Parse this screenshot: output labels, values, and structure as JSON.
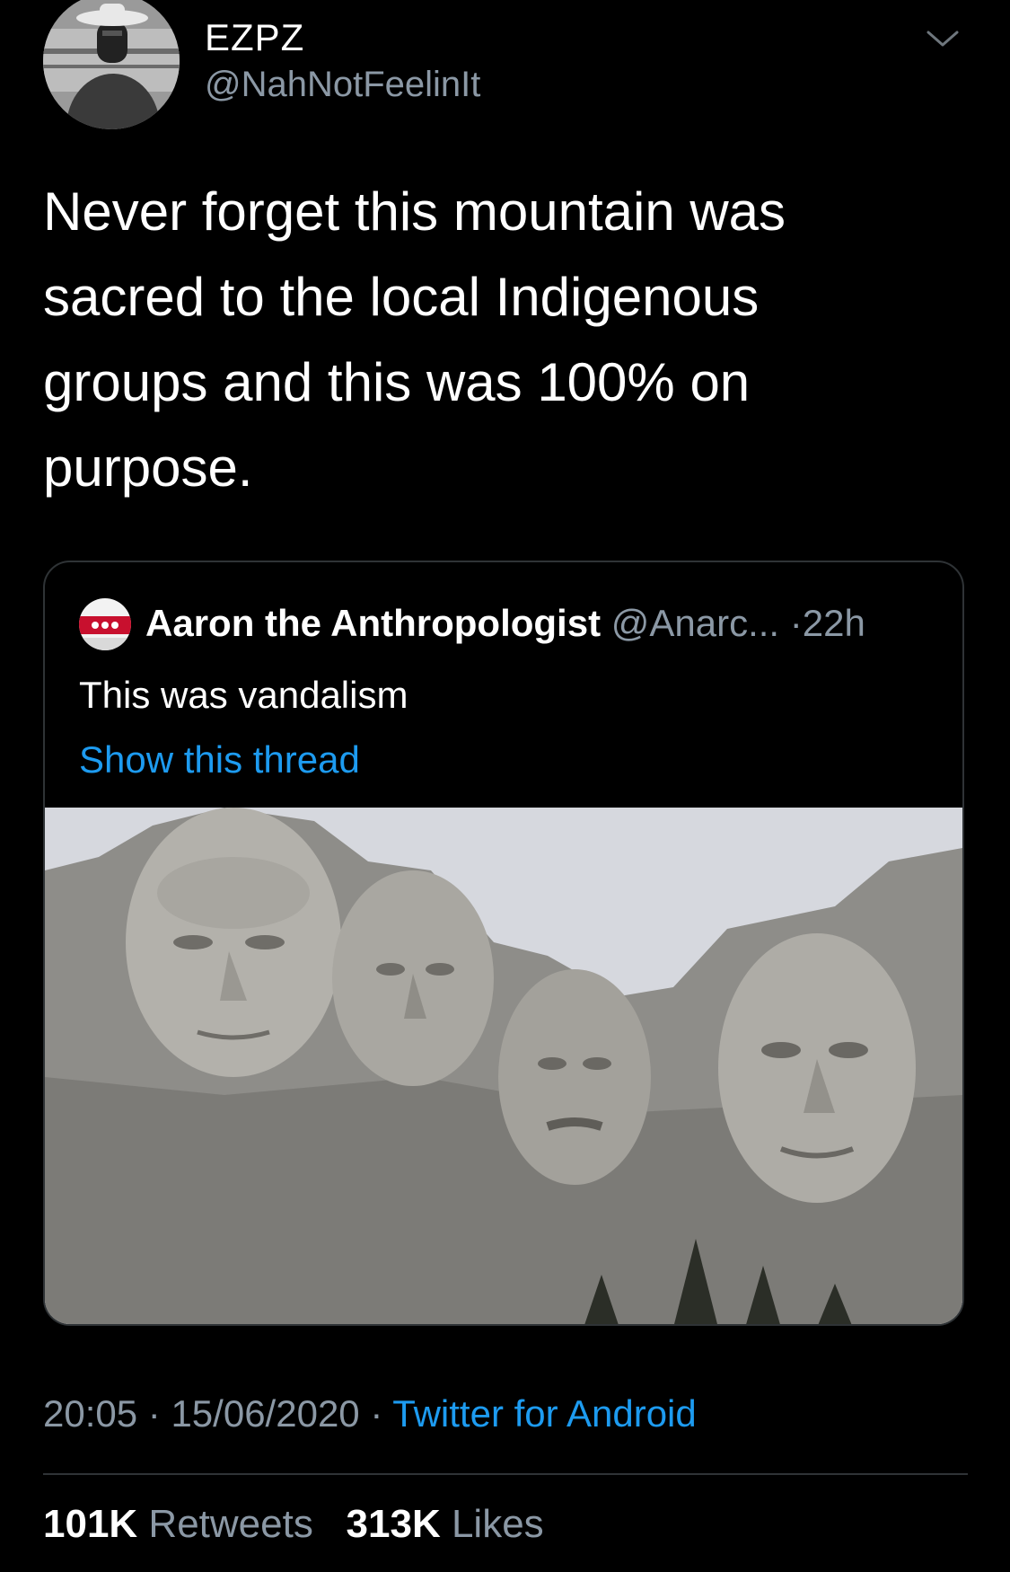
{
  "tweet": {
    "author": {
      "display_name": "EZPZ",
      "handle": "@NahNotFeelinIt"
    },
    "text": "Never forget this mountain was\nsacred to the local Indigenous\ngroups and this was 100% on\npurpose.",
    "quoted": {
      "name": "Aaron the Anthropologist",
      "handle": "@Anarc...",
      "separator": "·",
      "time": "22h",
      "text": "This was vandalism",
      "link_label": "Show this thread",
      "image_alt": "Mount Rushmore"
    },
    "meta": {
      "time": "20:05",
      "sep1": "·",
      "date": "15/06/2020",
      "sep2": "·",
      "source": "Twitter for Android"
    },
    "stats": {
      "retweets_count": "101K",
      "retweets_label": "Retweets",
      "likes_count": "313K",
      "likes_label": "Likes"
    }
  },
  "colors": {
    "background": "#000000",
    "text": "#ffffff",
    "secondary_text": "#8b98a5",
    "link": "#1d9bf0",
    "border": "#2f3336"
  },
  "icons": {
    "menu": "chevron-down-icon"
  }
}
